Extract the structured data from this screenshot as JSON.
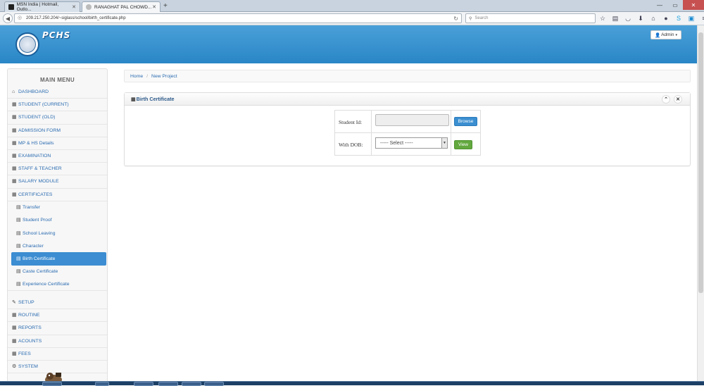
{
  "browser": {
    "tabs": [
      {
        "title": "MSN India | Hotmail, Outlo...",
        "active": false
      },
      {
        "title": "RANAGHAT PAL CHOWD...",
        "active": true
      }
    ],
    "url": "209.217.250.204/~siglass/school/birth_certificate.php",
    "search_placeholder": "Search"
  },
  "header": {
    "brand": "PCHS",
    "admin_label": "Admin",
    "brand_color": "#2a86c6"
  },
  "sidebar": {
    "title": "MAIN MENU",
    "items": [
      {
        "label": "DASHBOARD",
        "icon": "home-icon"
      },
      {
        "label": "STUDENT (CURRENT)",
        "icon": "grid-icon"
      },
      {
        "label": "STUDENT (OLD)",
        "icon": "grid-icon"
      },
      {
        "label": "ADMISSION FORM",
        "icon": "grid-icon"
      },
      {
        "label": "MP & HS Details",
        "icon": "grid-icon"
      },
      {
        "label": "EXAMINATION",
        "icon": "grid-icon"
      },
      {
        "label": "STAFF & TEACHER",
        "icon": "grid-icon"
      },
      {
        "label": "SALARY MODULE",
        "icon": "grid-icon"
      },
      {
        "label": "CERTIFICATES",
        "icon": "grid-icon"
      }
    ],
    "sub_items": [
      {
        "label": "Transfer",
        "active": false
      },
      {
        "label": "Student Proof",
        "active": false
      },
      {
        "label": "School Leaving",
        "active": false
      },
      {
        "label": "Character",
        "active": false
      },
      {
        "label": "Birth Certificate",
        "active": true
      },
      {
        "label": "Caste Certificate",
        "active": false
      },
      {
        "label": "Experience Certificate",
        "active": false
      }
    ],
    "items_after": [
      {
        "label": "SETUP",
        "icon": "wrench-icon"
      },
      {
        "label": "ROUTINE",
        "icon": "grid-icon"
      },
      {
        "label": "REPORTS",
        "icon": "grid-icon"
      },
      {
        "label": "ACOUNTS",
        "icon": "grid-icon"
      },
      {
        "label": "FEES",
        "icon": "grid-icon"
      },
      {
        "label": "SYSTEM",
        "icon": "cogs-icon"
      }
    ]
  },
  "breadcrumb": {
    "home": "Home",
    "current": "New Project"
  },
  "panel": {
    "title": "Birth Certificate",
    "form": {
      "student_id_label": "Student Id:",
      "student_id_value": "",
      "browse_label": "Browse",
      "dob_label": "With DOB:",
      "dob_selected": "----- Select -----",
      "view_label": "View"
    }
  }
}
